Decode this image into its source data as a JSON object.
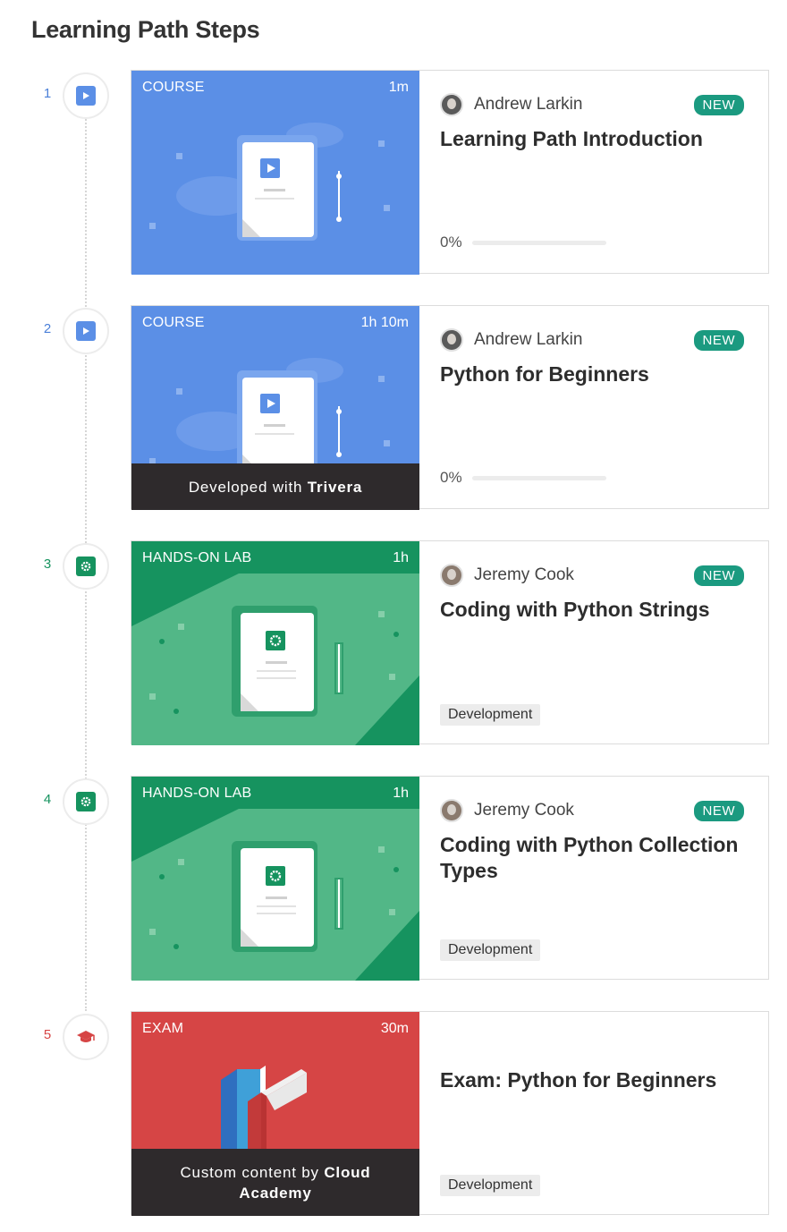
{
  "page_title": "Learning Path Steps",
  "colors": {
    "course_blue": "#5b8fe6",
    "lab_green": "#16935f",
    "exam_red": "#d64545",
    "new_badge": "#1b9a80",
    "footer_dark": "#2e2a2c"
  },
  "steps": [
    {
      "number": "1",
      "icon": "play-icon",
      "type_label": "COURSE",
      "duration": "1m",
      "author": "Andrew Larkin",
      "badge": "NEW",
      "title": "Learning Path Introduction",
      "progress_label": "0%",
      "progress": 0
    },
    {
      "number": "2",
      "icon": "play-icon",
      "type_label": "COURSE",
      "duration": "1h 10m",
      "footer_prefix": "Developed with ",
      "footer_bold": "Trivera",
      "author": "Andrew Larkin",
      "badge": "NEW",
      "title": "Python for Beginners",
      "progress_label": "0%",
      "progress": 0
    },
    {
      "number": "3",
      "icon": "gear-icon",
      "type_label": "HANDS-ON LAB",
      "duration": "1h",
      "author": "Jeremy Cook",
      "badge": "NEW",
      "title": "Coding with Python Strings",
      "tag": "Development"
    },
    {
      "number": "4",
      "icon": "gear-icon",
      "type_label": "HANDS-ON LAB",
      "duration": "1h",
      "author": "Jeremy Cook",
      "badge": "NEW",
      "title": "Coding with Python Collection Types",
      "tag": "Development"
    },
    {
      "number": "5",
      "icon": "graduation-cap-icon",
      "type_label": "EXAM",
      "duration": "30m",
      "footer_prefix": "Custom content by ",
      "footer_bold": "Cloud Academy",
      "title": "Exam: Python for Beginners",
      "tag": "Development"
    }
  ]
}
